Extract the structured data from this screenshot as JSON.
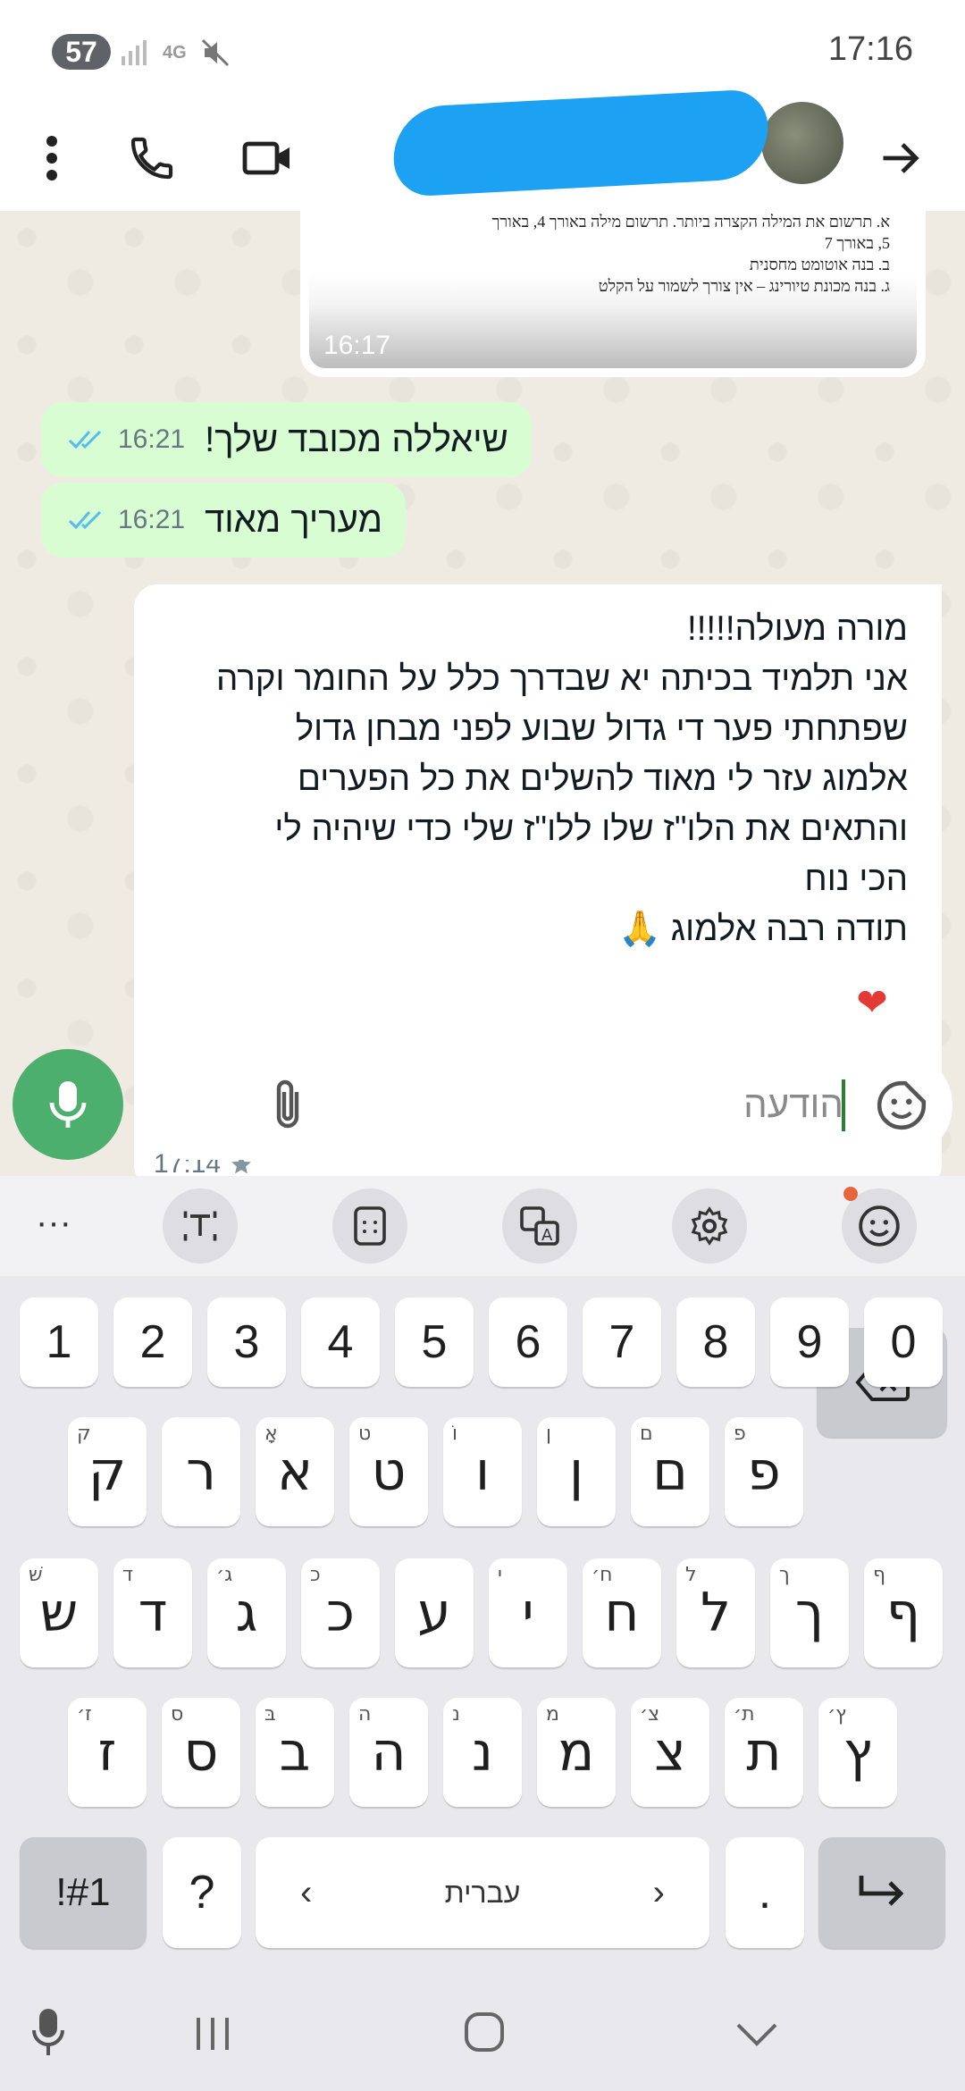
{
  "status_bar": {
    "battery": "57",
    "network": "4G",
    "time": "17:16"
  },
  "messages": {
    "image_message": {
      "lines": [
        "א. תרשום את המילה הקצרה ביותר. תרשום מילה באורך 4, באורך",
        "5, באורך 7",
        "ב. בנה אוטומט מחסנית",
        "ג. בנה מכונת טיורינג – אין צורך לשמור על הקלט"
      ],
      "time": "16:17"
    },
    "outgoing": [
      {
        "text": "שיאללה מכובד שלך!",
        "time": "16:21"
      },
      {
        "text": "מעריך מאוד",
        "time": "16:21"
      }
    ],
    "incoming": {
      "lines": [
        "מורה מעולה!!!!!",
        "אני תלמיד בכיתה יא שבדרך כלל על החומר וקרה",
        "שפתחתי פער די גדול שבוע לפני מבחן גדול",
        "אלמוג עזר לי מאוד להשלים את כל הפערים",
        "והתאים את הלו\"ז שלו ללו\"ז שלי כדי שיהיה לי",
        "הכי נוח",
        "תודה רבה אלמוג 🙏"
      ],
      "time": "17:14",
      "reaction": "❤"
    }
  },
  "composer": {
    "placeholder": "הודעה"
  },
  "keyboard": {
    "numbers": [
      "1",
      "2",
      "3",
      "4",
      "5",
      "6",
      "7",
      "8",
      "9",
      "0"
    ],
    "row1": [
      {
        "k": "ק",
        "h": "ק"
      },
      {
        "k": "ר",
        "h": ""
      },
      {
        "k": "א",
        "h": "אָ"
      },
      {
        "k": "ט",
        "h": "ט"
      },
      {
        "k": "ו",
        "h": "וֹ"
      },
      {
        "k": "ן",
        "h": "ן"
      },
      {
        "k": "ם",
        "h": "ם"
      },
      {
        "k": "פ",
        "h": "פ"
      }
    ],
    "row2": [
      {
        "k": "ש",
        "h": "שׁ"
      },
      {
        "k": "ד",
        "h": "ד"
      },
      {
        "k": "ג",
        "h": "ג׳"
      },
      {
        "k": "כ",
        "h": "כ"
      },
      {
        "k": "ע",
        "h": ""
      },
      {
        "k": "י",
        "h": "י"
      },
      {
        "k": "ח",
        "h": "ח׳"
      },
      {
        "k": "ל",
        "h": "ל"
      },
      {
        "k": "ך",
        "h": "ך"
      },
      {
        "k": "ף",
        "h": "ף"
      }
    ],
    "row3": [
      {
        "k": "ז",
        "h": "ז׳"
      },
      {
        "k": "ס",
        "h": "ס"
      },
      {
        "k": "ב",
        "h": "בּ"
      },
      {
        "k": "ה",
        "h": "ה"
      },
      {
        "k": "נ",
        "h": "נ"
      },
      {
        "k": "מ",
        "h": "מ"
      },
      {
        "k": "צ",
        "h": "צ׳"
      },
      {
        "k": "ת",
        "h": "ת׳"
      },
      {
        "k": "ץ",
        "h": "ץ׳"
      }
    ],
    "symbols_label": "!#1",
    "question": "?",
    "space_label": "עברית",
    "period": "."
  }
}
